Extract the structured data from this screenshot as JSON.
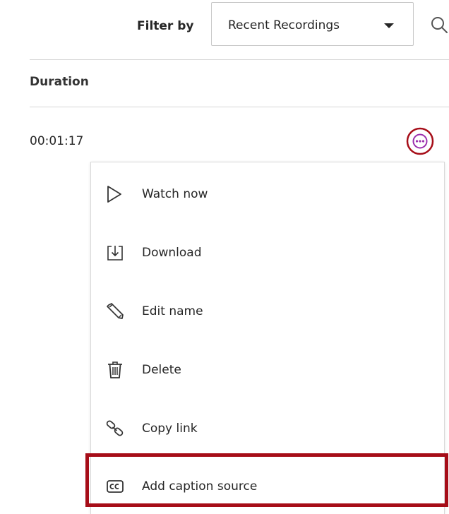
{
  "filter": {
    "label": "Filter by",
    "selected": "Recent Recordings"
  },
  "table": {
    "columns": [
      "Duration"
    ],
    "rows": [
      {
        "duration": "00:01:17"
      }
    ]
  },
  "menu": {
    "items": [
      {
        "label": "Watch now",
        "icon": "play-icon"
      },
      {
        "label": "Download",
        "icon": "download-icon"
      },
      {
        "label": "Edit name",
        "icon": "pencil-icon"
      },
      {
        "label": "Delete",
        "icon": "trash-icon"
      },
      {
        "label": "Copy link",
        "icon": "link-icon"
      },
      {
        "label": "Add caption source",
        "icon": "closed-caption-icon"
      }
    ]
  },
  "colors": {
    "highlight": "#a60d18",
    "more_button": "#9b2fae",
    "divider": "#d6d6d6"
  }
}
